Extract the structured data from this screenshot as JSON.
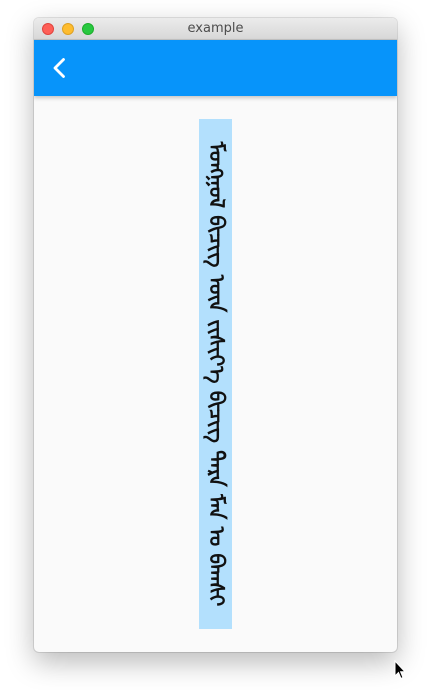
{
  "window": {
    "title": "example"
  },
  "appbar": {
    "color": "#0794fa",
    "back_icon": "chevron-left-icon"
  },
  "content": {
    "vertical_text": "ᠮᠣᠩᠭᠣᠯ ᠪᠢᠴᠢᠭ ᠦᠨ ᠵᠢᠱᠢᠶ᠎ᠡ ᠪᠢᠴᠢᠭ᠌ ᠲᠡᠷᠡ ᠮᠠᠨ ᠤ ᠪᠠᠭᠰᠢ",
    "highlight_color": "#b3e0fd"
  }
}
